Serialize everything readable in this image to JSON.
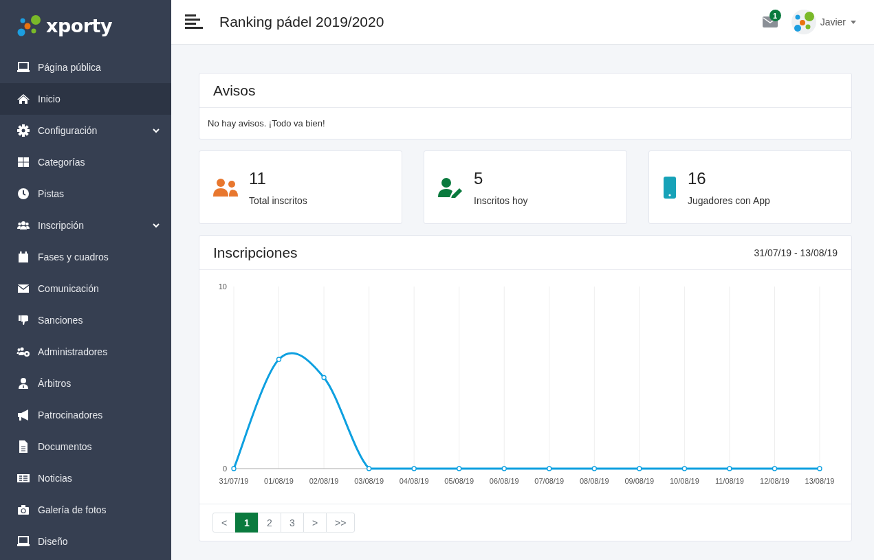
{
  "logo": "xporty",
  "sidebar": {
    "items": [
      {
        "label": "Página pública",
        "selected": false,
        "expandable": false
      },
      {
        "label": "Inicio",
        "selected": true,
        "expandable": false
      },
      {
        "label": "Configuración",
        "selected": false,
        "expandable": true
      },
      {
        "label": "Categorías",
        "selected": false,
        "expandable": false
      },
      {
        "label": "Pistas",
        "selected": false,
        "expandable": false
      },
      {
        "label": "Inscripción",
        "selected": false,
        "expandable": true
      },
      {
        "label": "Fases y cuadros",
        "selected": false,
        "expandable": false
      },
      {
        "label": "Comunicación",
        "selected": false,
        "expandable": false
      },
      {
        "label": "Sanciones",
        "selected": false,
        "expandable": false
      },
      {
        "label": "Administradores",
        "selected": false,
        "expandable": false
      },
      {
        "label": "Árbitros",
        "selected": false,
        "expandable": false
      },
      {
        "label": "Patrocinadores",
        "selected": false,
        "expandable": false
      },
      {
        "label": "Documentos",
        "selected": false,
        "expandable": false
      },
      {
        "label": "Noticias",
        "selected": false,
        "expandable": false
      },
      {
        "label": "Galería de fotos",
        "selected": false,
        "expandable": false
      },
      {
        "label": "Diseño",
        "selected": false,
        "expandable": false
      }
    ]
  },
  "header": {
    "title": "Ranking pádel 2019/2020",
    "messages_badge": "1",
    "user": "Javier"
  },
  "notices": {
    "title": "Avisos",
    "message": "No hay avisos. ¡Todo va bien!"
  },
  "stats": [
    {
      "value": "11",
      "label": "Total inscritos",
      "color": "#e8772e"
    },
    {
      "value": "5",
      "label": "Inscritos hoy",
      "color": "#0a7a3e"
    },
    {
      "value": "16",
      "label": "Jugadores con App",
      "color": "#17a2b8"
    }
  ],
  "chart_card": {
    "title": "Inscripciones",
    "range": "31/07/19 - 13/08/19",
    "chart_data": {
      "type": "line",
      "categories": [
        "31/07/19",
        "01/08/19",
        "02/08/19",
        "03/08/19",
        "04/08/19",
        "05/08/19",
        "06/08/19",
        "07/08/19",
        "08/08/19",
        "09/08/19",
        "10/08/19",
        "11/08/19",
        "12/08/19",
        "13/08/19"
      ],
      "series": [
        {
          "color": "#0ea0e0",
          "marker": true,
          "values": [
            0,
            6,
            5,
            0,
            0,
            0,
            0,
            0,
            0,
            0,
            0,
            0,
            0,
            0
          ]
        }
      ],
      "ylim": [
        0,
        10
      ],
      "yticks": [
        0,
        10
      ],
      "grid": true
    }
  },
  "pagination": [
    {
      "label": "<",
      "selected": false
    },
    {
      "label": "1",
      "selected": true
    },
    {
      "label": "2",
      "selected": false
    },
    {
      "label": "3",
      "selected": false
    },
    {
      "label": ">",
      "selected": false
    },
    {
      "label": ">>",
      "selected": false
    }
  ]
}
